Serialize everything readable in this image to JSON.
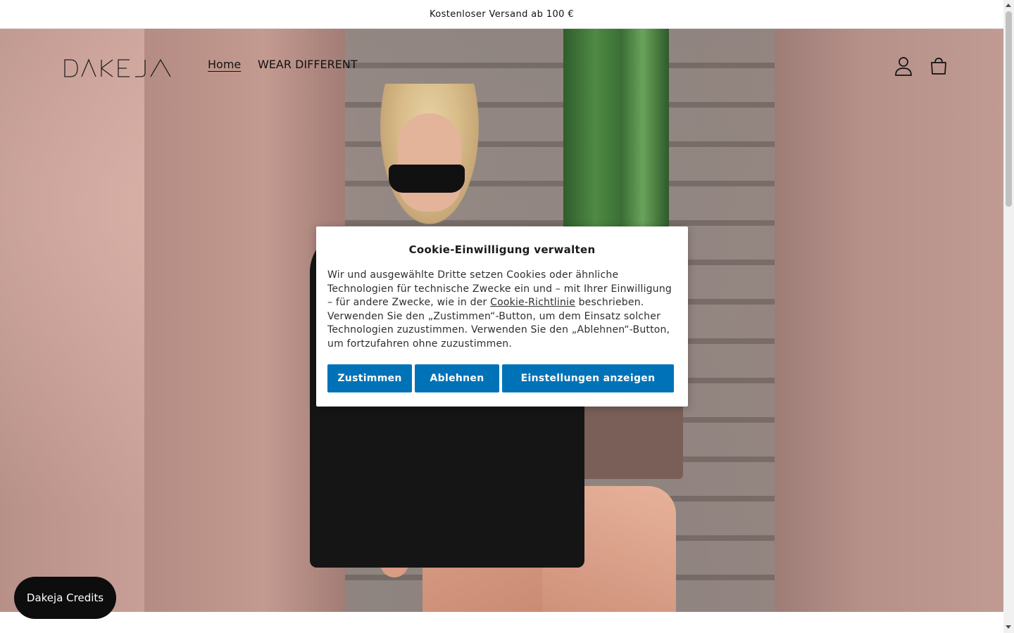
{
  "announcement": {
    "text": "Kostenloser Versand ab 100 €"
  },
  "header": {
    "logo_text": "DAKEJA",
    "nav": [
      {
        "label": "Home",
        "active": true
      },
      {
        "label": "WEAR DIFFERENT",
        "active": false
      }
    ],
    "icons": [
      "account-icon",
      "cart-icon"
    ]
  },
  "cookie": {
    "title": "Cookie-Einwilligung verwalten",
    "text_before_link": "Wir und ausgewählte Dritte setzen Cookies oder ähnliche Technologien für technische Zwecke ein und – mit Ihrer Einwilligung – für andere Zwecke, wie in der ",
    "link_text": "Cookie-Richtlinie",
    "text_after_link": " beschrieben. Verwenden Sie den „Zustimmen“-Button, um dem Einsatz solcher Technologien zuzustimmen. Verwenden Sie den „Ablehnen“-Button, um fortzufahren ohne zuzustimmen.",
    "buttons": {
      "accept": "Zustimmen",
      "reject": "Ablehnen",
      "settings": "Einstellungen anzeigen"
    },
    "button_color": "#0073b8"
  },
  "credits": {
    "label": "Dakeja Credits"
  }
}
